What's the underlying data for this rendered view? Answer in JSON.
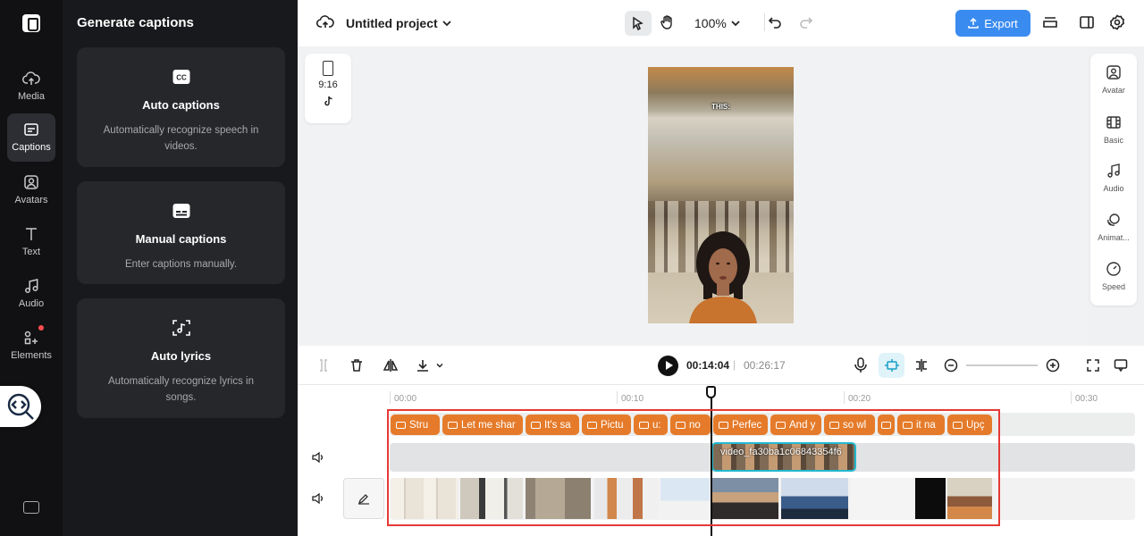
{
  "rail": {
    "items": [
      {
        "label": "Media",
        "icon": "cloud-upload-icon"
      },
      {
        "label": "Captions",
        "icon": "captions-icon",
        "active": true
      },
      {
        "label": "Avatars",
        "icon": "avatar-icon"
      },
      {
        "label": "Text",
        "icon": "text-icon"
      },
      {
        "label": "Audio",
        "icon": "music-note-icon"
      },
      {
        "label": "Elements",
        "icon": "elements-icon",
        "badge": true
      }
    ]
  },
  "panel": {
    "title": "Generate captions",
    "cards": [
      {
        "title": "Auto captions",
        "desc": "Automatically recognize speech in videos.",
        "icon": "cc-icon"
      },
      {
        "title": "Manual captions",
        "desc": "Enter captions manually.",
        "icon": "subtitle-icon"
      },
      {
        "title": "Auto lyrics",
        "desc": "Automatically recognize lyrics in songs.",
        "icon": "lyrics-icon"
      }
    ]
  },
  "topbar": {
    "project_name": "Untitled project",
    "zoom": "100%",
    "export_label": "Export"
  },
  "canvas": {
    "ratio_label": "9:16",
    "caption_text": "THIS:"
  },
  "right_panel": {
    "items": [
      "Avatar",
      "Basic",
      "Audio",
      "Animat...",
      "Speed"
    ]
  },
  "playback": {
    "current": "00:14:04",
    "separator": "|",
    "total": "00:26:17"
  },
  "timeline": {
    "ruler": [
      "00:00",
      "00:10",
      "00:20",
      "00:30"
    ],
    "captions": [
      "Stru",
      "Let me shar",
      "It's sa",
      "Pictu",
      "u:",
      "no",
      "Perfec",
      "And y",
      "so wl",
      "",
      "it na",
      "Upç"
    ],
    "video_clip_name": "video_fa30ba1c06843354f6"
  },
  "colors": {
    "accent": "#3a8bf0",
    "caption_chip": "#e57b2a",
    "selection": "#e53935",
    "clip_border": "#22b8cf"
  }
}
